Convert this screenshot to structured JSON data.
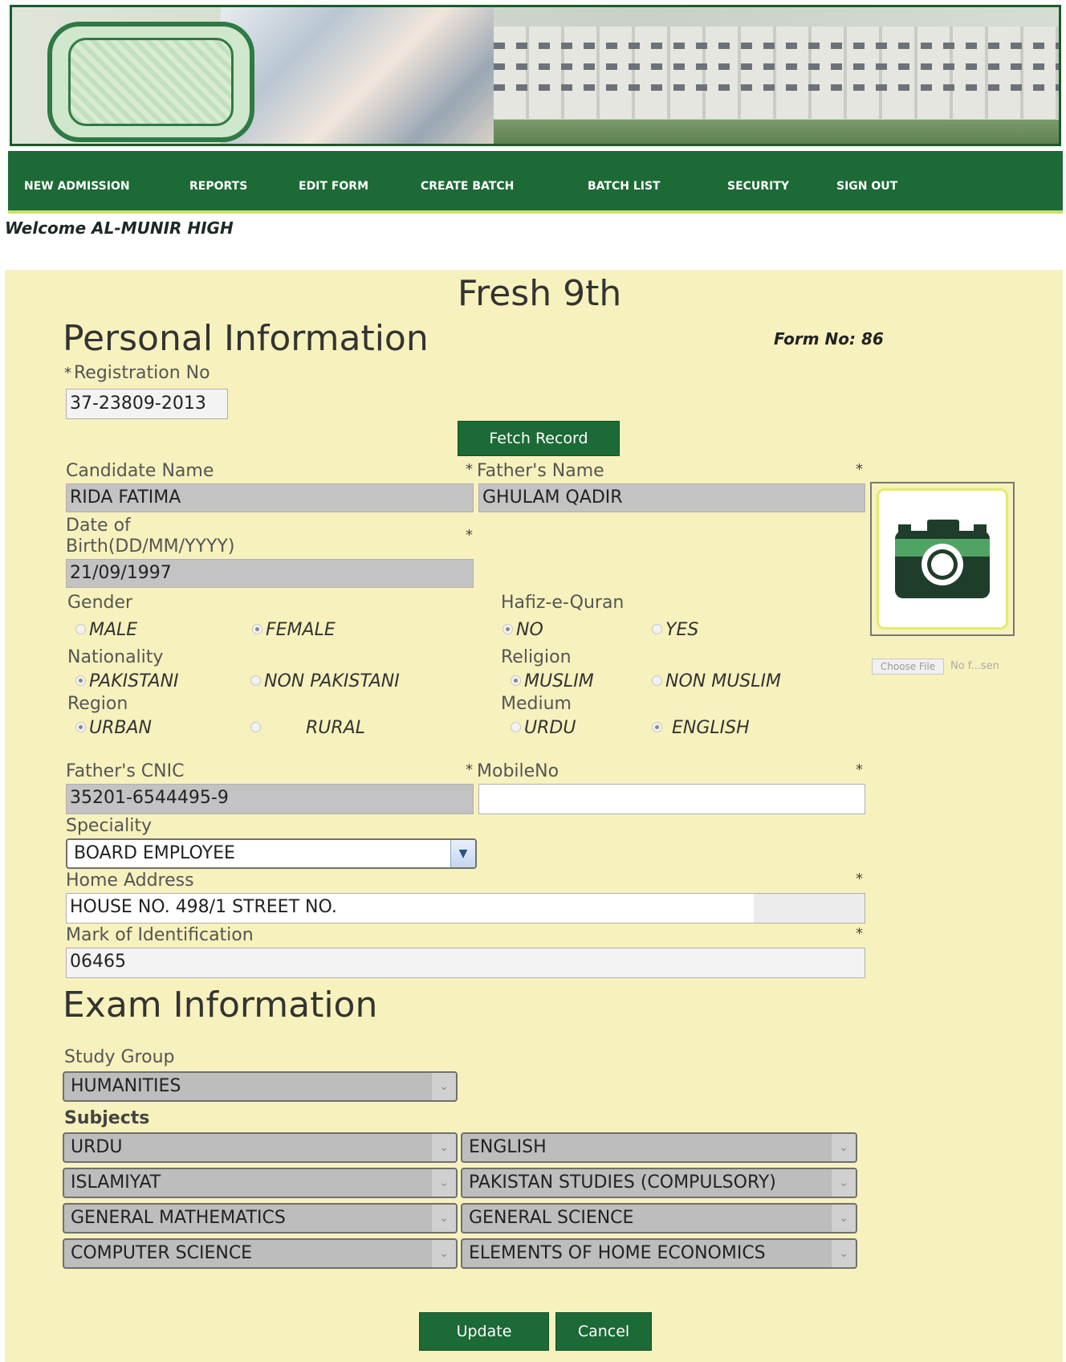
{
  "nav": {
    "items": [
      "NEW ADMISSION",
      "REPORTS",
      "EDIT FORM",
      "CREATE BATCH",
      "BATCH LIST",
      "SECURITY",
      "SIGN OUT"
    ]
  },
  "welcome": "Welcome AL-MUNIR HIGH",
  "form": {
    "title": "Fresh 9th",
    "form_no": "Form No: 86",
    "personal_heading": "Personal Information",
    "registration_label": "Registration No",
    "registration_value": "37-23809-2013",
    "fetch_label": "Fetch Record",
    "candidate_name_label": "Candidate Name",
    "candidate_name_value": "RIDA FATIMA",
    "father_name_label": "Father's Name",
    "father_name_value": "GHULAM QADIR",
    "dob_label_1": "Date of",
    "dob_label_2": "Birth(DD/MM/YYYY)",
    "dob_value": "21/09/1997",
    "gender_label": "Gender",
    "gender_options": [
      "MALE",
      "FEMALE"
    ],
    "gender_selected": "FEMALE",
    "hafiz_label": "Hafiz-e-Quran",
    "hafiz_options": [
      "NO",
      "YES"
    ],
    "hafiz_selected": "NO",
    "nationality_label": "Nationality",
    "nationality_options": [
      "PAKISTANI",
      "NON PAKISTANI"
    ],
    "nationality_selected": "PAKISTANI",
    "religion_label": "Religion",
    "religion_options": [
      "MUSLIM",
      "NON MUSLIM"
    ],
    "religion_selected": "MUSLIM",
    "region_label": "Region",
    "region_options": [
      "URBAN",
      "RURAL"
    ],
    "region_selected": "URBAN",
    "medium_label": "Medium",
    "medium_options": [
      "URDU",
      "ENGLISH"
    ],
    "medium_selected": "ENGLISH",
    "father_cnic_label": "Father's CNIC",
    "father_cnic_value": "35201-6544495-9",
    "mobile_label": "MobileNo",
    "mobile_value": "",
    "speciality_label": "Speciality",
    "speciality_value": "BOARD EMPLOYEE",
    "home_address_label": "Home Address",
    "home_address_value": "HOUSE NO. 498/1 STREET NO.",
    "mark_label": "Mark of Identification",
    "mark_value": "06465",
    "choose_file_label": "Choose File",
    "no_file_text": "No f...sen",
    "required_marker": "*",
    "exam_heading": "Exam Information",
    "study_group_label": "Study Group",
    "study_group_value": "HUMANITIES",
    "subjects_label": "Subjects",
    "subjects": [
      [
        "URDU",
        "ENGLISH"
      ],
      [
        "ISLAMIYAT",
        "PAKISTAN STUDIES (COMPULSORY)"
      ],
      [
        "GENERAL MATHEMATICS",
        "GENERAL SCIENCE"
      ],
      [
        "COMPUTER SCIENCE",
        "ELEMENTS OF HOME ECONOMICS"
      ]
    ],
    "update_label": "Update",
    "cancel_label": "Cancel"
  },
  "colors": {
    "nav_bg": "#1c6a36",
    "panel_bg": "#f7f1bd",
    "field_bg": "#c3c3c3",
    "accent": "#cbe26a"
  },
  "icons": [
    "camera-icon",
    "chevron-down-icon",
    "school-logo"
  ]
}
